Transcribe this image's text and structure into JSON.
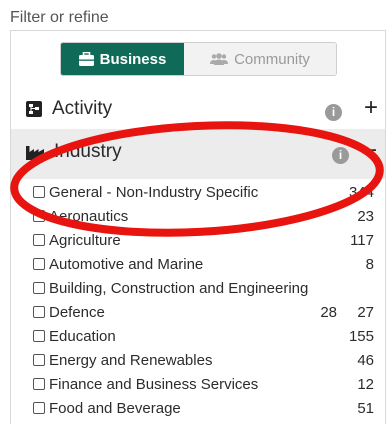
{
  "filter_title": "Filter or refine",
  "toggle": {
    "active": {
      "label": "Business",
      "icon": "briefcase-icon"
    },
    "inactive": {
      "label": "Community",
      "icon": "users-icon"
    }
  },
  "sections": {
    "activity": {
      "label": "Activity",
      "icon": "sitemap-icon",
      "info": "i",
      "state_symbol": "+"
    },
    "industry": {
      "label": "Industry",
      "icon": "industry-icon",
      "info": "i",
      "state_symbol": "−"
    }
  },
  "industry_items": [
    {
      "label": "General - Non-Industry Specific",
      "count": "344"
    },
    {
      "label": "Aeronautics",
      "count": "23"
    },
    {
      "label": "Agriculture",
      "count": "117"
    },
    {
      "label": "Automotive and Marine",
      "count": "8"
    },
    {
      "label": "Building, Construction and Engineering",
      "count": ""
    },
    {
      "label": "Defence",
      "count": "27",
      "count_extra": "28"
    },
    {
      "label": "Education",
      "count": "155"
    },
    {
      "label": "Energy and Renewables",
      "count": "46"
    },
    {
      "label": "Finance and Business Services",
      "count": "12"
    },
    {
      "label": "Food and Beverage",
      "count": "51"
    }
  ],
  "colors": {
    "primary": "#0f6b58",
    "annotation": "#e8140f",
    "section_active_bg": "#ececec"
  }
}
